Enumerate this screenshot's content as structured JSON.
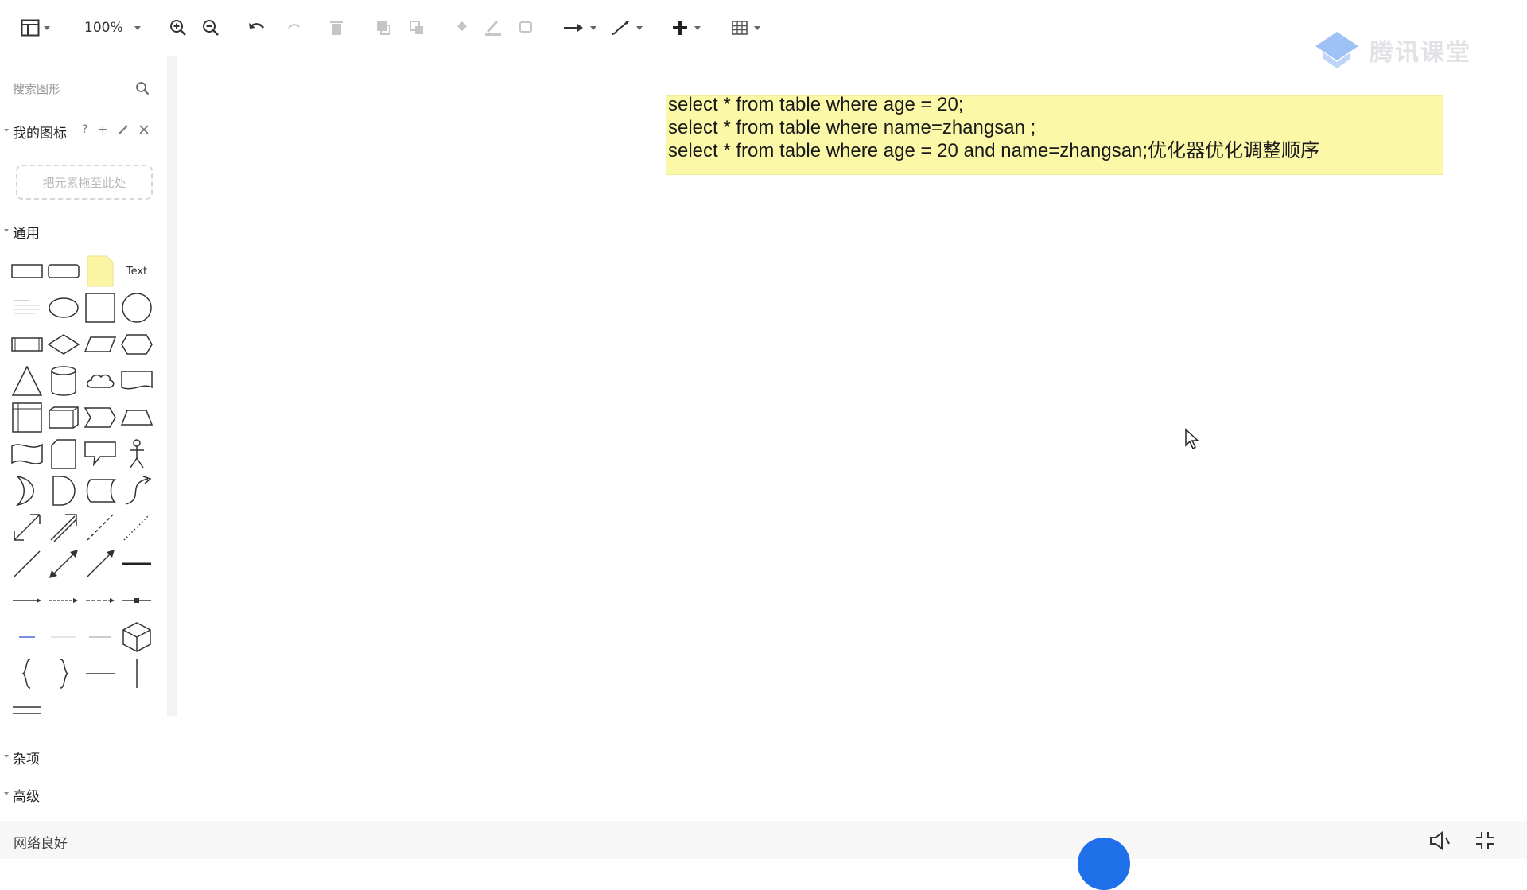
{
  "toolbar": {
    "zoom_level": "100%",
    "icons": [
      "sidebar-toggle-icon",
      "zoom-in-icon",
      "zoom-out-icon",
      "undo-icon",
      "redo-icon",
      "delete-icon",
      "to-front-icon",
      "to-back-icon",
      "fill-color-icon",
      "line-color-icon",
      "shadow-icon",
      "connection-icon",
      "waypoints-icon",
      "insert-icon",
      "table-icon"
    ]
  },
  "sidebar": {
    "search_placeholder": "搜索图形",
    "my_shapes": {
      "title": "我的图标",
      "help": "?",
      "add": "+",
      "dropzone_text": "把元素拖至此处"
    },
    "general": {
      "title": "通用",
      "text_shape_label": "Text"
    },
    "misc_title": "杂项",
    "advanced_title": "高级"
  },
  "canvas": {
    "note_lines": [
      "select * from table where age = 20;",
      "select * from table where name=zhangsan ;",
      "select * from table where age = 20 and name=zhangsan;优化器优化调整顺序"
    ],
    "note_color": "#fbf9a8",
    "watermark_text": "腾讯课堂"
  },
  "statusbar": {
    "network_status": "网络良好"
  },
  "colors": {
    "live_badge": "#1e6fe8",
    "accent_watermark": "#4f8ff0"
  }
}
